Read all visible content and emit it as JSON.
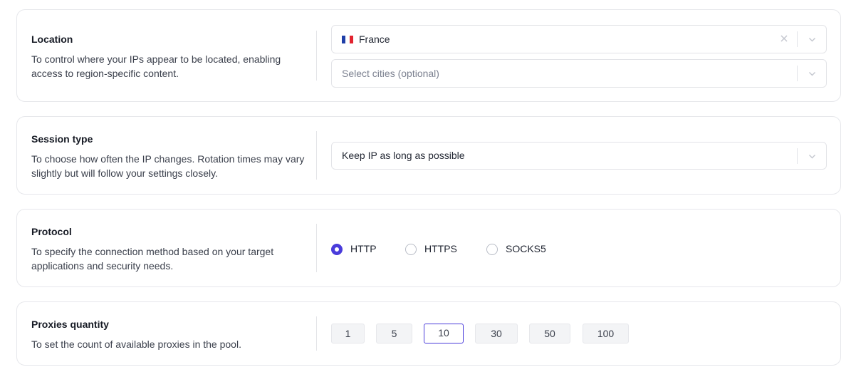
{
  "location": {
    "title": "Location",
    "description": "To control where your IPs appear to be located, enabling access to region-specific content.",
    "country_value": "France",
    "country_flag": "flag-france-icon",
    "cities_placeholder": "Select cities (optional)"
  },
  "session": {
    "title": "Session type",
    "description": "To choose how often the IP changes. Rotation times may vary slightly but will follow your settings closely.",
    "value": "Keep IP as long as possible"
  },
  "protocol": {
    "title": "Protocol",
    "description": "To specify the connection method based on your target applications and security needs.",
    "options": [
      "HTTP",
      "HTTPS",
      "SOCKS5"
    ],
    "selected": "HTTP"
  },
  "quantity": {
    "title": "Proxies quantity",
    "description": "To set the count of available proxies in the pool.",
    "options": [
      "1",
      "5",
      "10",
      "30",
      "50",
      "100"
    ],
    "selected": "10"
  },
  "colors": {
    "accent": "#4a3cdb",
    "border": "#e6e7eb",
    "chip_bg": "#f3f4f6",
    "flag_blue": "#1f3fa8",
    "flag_white": "#ffffff",
    "flag_red": "#e2232f"
  }
}
